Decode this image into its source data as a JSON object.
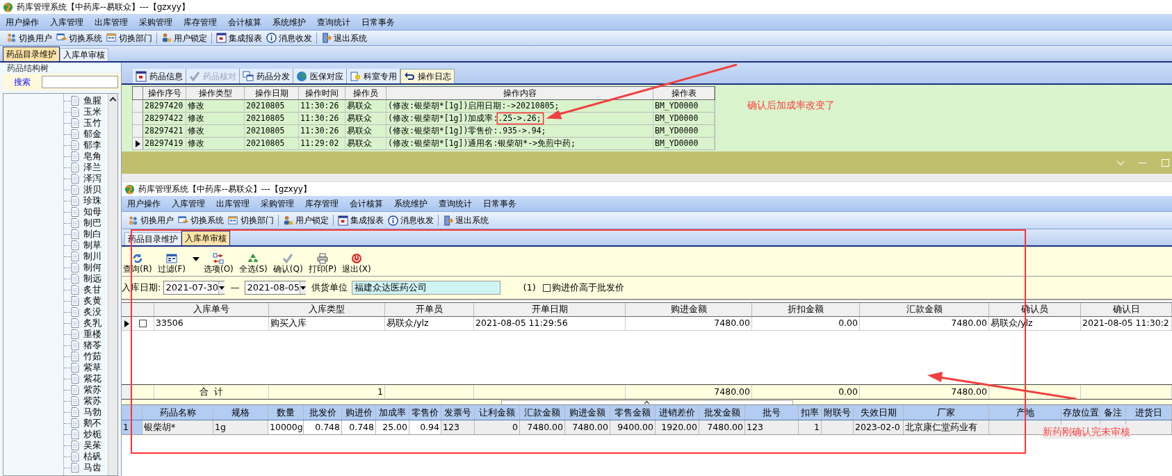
{
  "window": {
    "title": "药库管理系统【中药库--易联众】---【gzxyy】"
  },
  "menu": [
    "用户操作",
    "入库管理",
    "出库管理",
    "采购管理",
    "库存管理",
    "会计核算",
    "系统维护",
    "查询统计",
    "日常事务"
  ],
  "toolbar": [
    {
      "label": "切换用户"
    },
    {
      "label": "切换系统"
    },
    {
      "label": "切换部门"
    },
    {
      "label": "用户锁定"
    },
    {
      "label": "集成报表"
    },
    {
      "label": "消息收发"
    },
    {
      "label": "退出系统"
    }
  ],
  "tabs": [
    {
      "label": "药品目录维护",
      "selected": true
    },
    {
      "label": "入库单审核",
      "selected": false
    }
  ],
  "tree_panel": {
    "title": "药品结构树",
    "search_label": "搜索",
    "items": [
      "鱼腥",
      "玉米",
      "玉竹",
      "郁金",
      "郁李",
      "皂角",
      "泽兰",
      "泽泻",
      "浙贝",
      "珍珠",
      "知母",
      "制巴",
      "制白",
      "制草",
      "制川",
      "制何",
      "制远",
      "炙甘",
      "炙黄",
      "炙没",
      "炙乳",
      "重楼",
      "猪苓",
      "竹茹",
      "紫草",
      "紫花",
      "紫苏",
      "紫苏",
      "马勃",
      "鹅不",
      "炒栀",
      "吴茱",
      "枯矾",
      "马齿"
    ]
  },
  "sub_tabs": [
    {
      "label": "药品信息",
      "selected": false,
      "disabled": false
    },
    {
      "label": "药品核对",
      "selected": false,
      "disabled": true
    },
    {
      "label": "药品分发",
      "selected": false,
      "disabled": false
    },
    {
      "label": "医保对应",
      "selected": false,
      "disabled": false
    },
    {
      "label": "科室专用",
      "selected": false,
      "disabled": false
    },
    {
      "label": "操作日志",
      "selected": true,
      "disabled": false
    }
  ],
  "log_table": {
    "columns": [
      "操作序号",
      "操作类型",
      "操作日期",
      "操作时间",
      "操作员",
      "操作内容",
      "操作表"
    ],
    "rows": [
      {
        "current": false,
        "cells": [
          "28297420",
          "修改",
          "20210805",
          "11:30:26",
          "易联众",
          "(修改:银柴胡*[1g])启用日期:->20210805;",
          "BM_YD0000"
        ]
      },
      {
        "current": false,
        "cells": [
          "28297422",
          "修改",
          "20210805",
          "11:30:26",
          "易联众",
          "(修改:银柴胡*[1g])加成率:.25->.26;",
          "BM_YD0000"
        ]
      },
      {
        "current": false,
        "cells": [
          "28297421",
          "修改",
          "20210805",
          "11:30:26",
          "易联众",
          "(修改:银柴胡*[1g])零售价:.935->.94;",
          "BM_YD0000"
        ]
      },
      {
        "current": true,
        "cells": [
          "28297419",
          "修改",
          "20210805",
          "11:29:02",
          "易联众",
          "(修改:银柴胡*[1g])通用名:银柴胡*->免煎中药;",
          "BM_YD0000"
        ]
      }
    ]
  },
  "annotations": [
    {
      "text": "确认后加成率改变了"
    },
    {
      "text": "新药刚确认完未审核"
    }
  ],
  "inner_window": {
    "title": "药库管理系统【中药库--易联众】---【gzxyy】",
    "menu": [
      "用户操作",
      "入库管理",
      "出库管理",
      "采购管理",
      "库存管理",
      "会计核算",
      "系统维护",
      "查询统计",
      "日常事务"
    ],
    "toolbar": [
      {
        "label": "切换用户"
      },
      {
        "label": "切换系统"
      },
      {
        "label": "切换部门"
      },
      {
        "label": "用户锁定"
      },
      {
        "label": "集成报表"
      },
      {
        "label": "消息收发"
      },
      {
        "label": "退出系统"
      }
    ],
    "tabs": [
      {
        "label": "药品目录维护",
        "selected": false
      },
      {
        "label": "入库单审核",
        "selected": true
      }
    ],
    "actions": [
      {
        "label": "查询(R)",
        "dropdown": false
      },
      {
        "label": "过滤(F)",
        "dropdown": true
      },
      {
        "label": "选项(O)",
        "dropdown": false
      },
      {
        "label": "全选(S)",
        "dropdown": false
      },
      {
        "label": "确认(Q)",
        "dropdown": false
      },
      {
        "label": "打印(P)",
        "dropdown": false
      },
      {
        "label": "退出(X)",
        "dropdown": false
      }
    ],
    "filter": {
      "label": "入库日期:",
      "date_from": "2021-07-30",
      "separator": "—",
      "date_to": "2021-08-05",
      "supplier_label": "供货单位",
      "supplier": "福建众达医药公司",
      "count": "(1)",
      "option": {
        "label": "购进价高于批发价",
        "checked": false
      }
    },
    "master_table": {
      "columns": [
        "入库单号",
        "入库类型",
        "开单员",
        "开单日期",
        "购进金额",
        "折扣金额",
        "汇款金额",
        "确认员",
        "确认日"
      ],
      "rows": [
        {
          "current": true,
          "checked": false,
          "cells": [
            "33506",
            "购买入库",
            "易联众/ylz",
            "2021-08-05 11:29:56",
            "7480.00",
            "0.00",
            "7480.00",
            "易联众/ylz",
            "2021-08-05 11:30:2"
          ]
        }
      ],
      "totals": {
        "label": "合  计",
        "count": "1",
        "amounts": [
          "7480.00",
          "0.00",
          "7480.00"
        ]
      }
    },
    "detail_table": {
      "columns": [
        "药品名称",
        "规格",
        "数量",
        "批发价",
        "购进价",
        "加成率",
        "零售价",
        "发票号",
        "让利金额",
        "汇款金额",
        "购进金额",
        "零售金额",
        "进销差价",
        "批发金额",
        "批号",
        "扣率",
        "附联号",
        "失效日期",
        "厂家",
        "产地",
        "存放位置",
        "备注",
        "进货日"
      ],
      "rows": [
        {
          "row_number": "1",
          "cells": [
            "银柴胡*",
            "1g",
            "10000g",
            "0.748",
            "0.748",
            "25.00",
            "0.94",
            "123",
            "0",
            "7480.00",
            "7480.00",
            "9400.00",
            "1920.00",
            "7480.00",
            "123",
            "1",
            null,
            "2023-02-0",
            "北京康仁堂药业有",
            null,
            null,
            null,
            null
          ]
        }
      ]
    }
  }
}
